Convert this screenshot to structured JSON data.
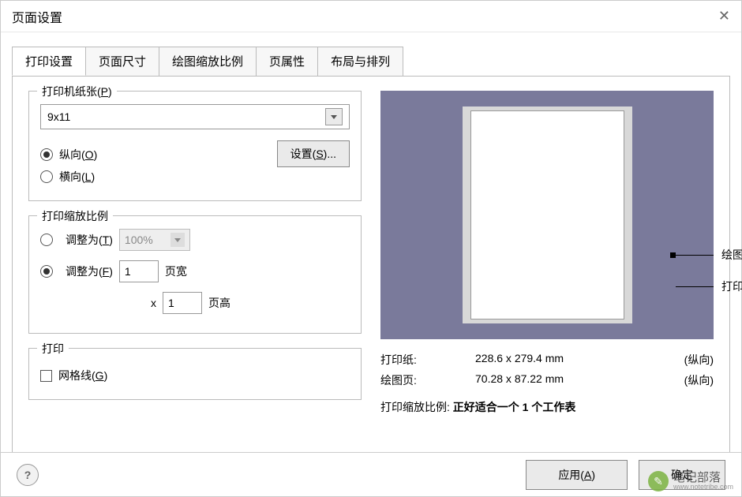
{
  "dialog": {
    "title": "页面设置"
  },
  "tabs": [
    {
      "label": "打印设置",
      "active": true
    },
    {
      "label": "页面尺寸",
      "active": false
    },
    {
      "label": "绘图缩放比例",
      "active": false
    },
    {
      "label": "页属性",
      "active": false
    },
    {
      "label": "布局与排列",
      "active": false
    }
  ],
  "paper": {
    "group_label": "打印机纸张(P)",
    "size": "9x11",
    "orientation": {
      "portrait_label": "纵向(O)",
      "landscape_label": "横向(L)",
      "selected": "portrait"
    },
    "setup_btn": "设置(S)..."
  },
  "scale": {
    "group_label": "打印缩放比例",
    "adjust_to_label": "调整为(T)",
    "adjust_to_value": "100%",
    "fit_to_label": "调整为(F)",
    "fit_wide_value": "1",
    "fit_wide_label": "页宽",
    "x_label": "x",
    "fit_tall_value": "1",
    "fit_tall_label": "页高",
    "selected": "fit"
  },
  "print": {
    "group_label": "打印",
    "gridlines_label": "网格线(G)",
    "gridlines_checked": false
  },
  "preview": {
    "callout_drawing": "绘图页",
    "callout_paper": "打印纸"
  },
  "info": {
    "paper_label": "打印纸:",
    "paper_value": "228.6 x 279.4 mm",
    "paper_orient": "(纵向)",
    "drawing_label": "绘图页:",
    "drawing_value": "70.28 x 87.22 mm",
    "drawing_orient": "(纵向)",
    "scale_label": "打印缩放比例:",
    "scale_value": "正好适合一个 1 个工作表"
  },
  "footer": {
    "apply": "应用(A)",
    "ok": "确定"
  },
  "watermark": {
    "cn": "笔记部落",
    "en": "www.notetribe.com"
  }
}
